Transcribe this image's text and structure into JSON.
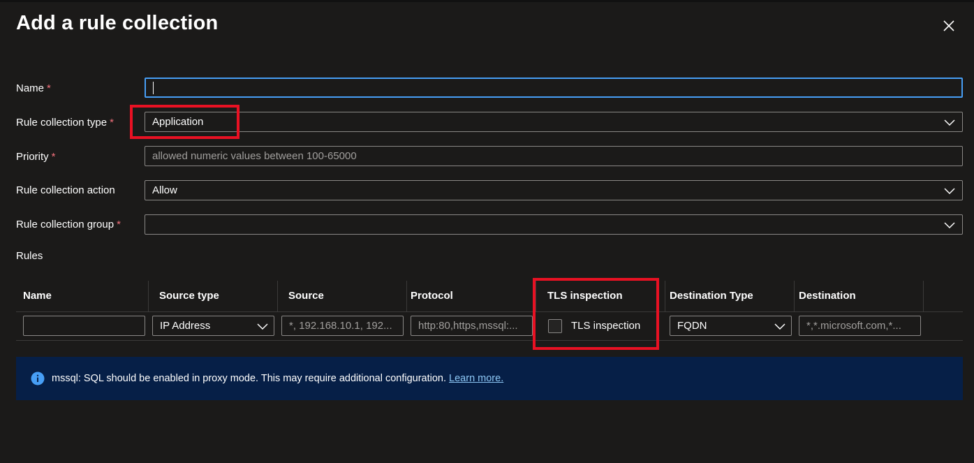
{
  "dialog": {
    "title": "Add a rule collection"
  },
  "form": {
    "name": {
      "label": "Name",
      "required": "*",
      "value": ""
    },
    "type": {
      "label": "Rule collection type",
      "required": "*",
      "value": "Application"
    },
    "priority": {
      "label": "Priority",
      "required": "*",
      "placeholder": "allowed numeric values between 100-65000"
    },
    "action": {
      "label": "Rule collection action",
      "value": "Allow"
    },
    "group": {
      "label": "Rule collection group",
      "required": "*",
      "value": ""
    }
  },
  "rules": {
    "label": "Rules",
    "columns": [
      "Name",
      "Source type",
      "Source",
      "Protocol",
      "TLS inspection",
      "Destination Type",
      "Destination"
    ],
    "row": {
      "name": "",
      "source_type": "IP Address",
      "source_placeholder": "*, 192.168.10.1, 192...",
      "protocol_placeholder": "http:80,https,mssql:...",
      "tls_label": "TLS inspection",
      "dest_type": "FQDN",
      "dest_placeholder": "*,*.microsoft.com,*..."
    }
  },
  "info": {
    "text": "mssql: SQL should be enabled in proxy mode. This may require additional configuration. ",
    "link": "Learn more."
  },
  "colors": {
    "background": "#1b1a19",
    "highlight": "#e81123",
    "focus": "#479ef5",
    "info_bg": "#061f47",
    "link": "#8ec8f6",
    "required": "#f1707b"
  },
  "icons": {
    "close": "close-icon",
    "dropdown": "chevron-down-icon",
    "info": "info-icon"
  }
}
